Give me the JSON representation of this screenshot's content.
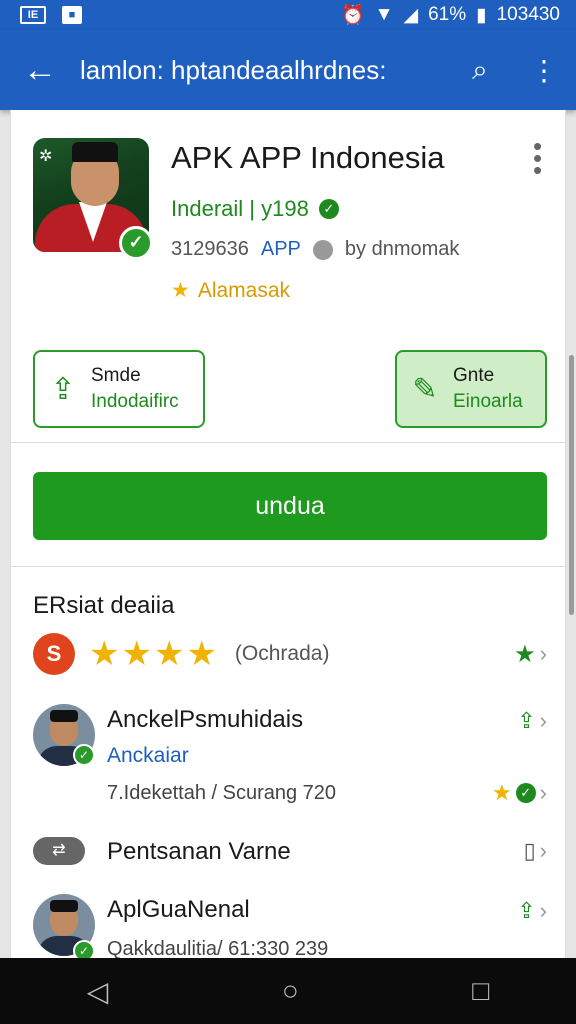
{
  "status_bar": {
    "left_icons": [
      "IE",
      "■"
    ],
    "alarm_icon": "alarm-icon",
    "signal_icon": "signal-icon",
    "battery": "61%",
    "time": "103430"
  },
  "app_bar": {
    "back_icon": "←",
    "title": "lamlon: hptandeaalhrdnes:",
    "search_icon": "⌕",
    "more_icon": "⋮"
  },
  "app": {
    "title": "APK APP Indonesia",
    "developer": "Inderail | y198",
    "downloads": "3129636",
    "type_tag": "APP",
    "by": "by dnmomak",
    "award": "Alamasak",
    "overflow_icon": "⋮"
  },
  "actions": {
    "share_l1": "Smde",
    "share_l2": "Indodaifirc",
    "edit_l1": "Gnte",
    "edit_l2": "Einoarla"
  },
  "install_label": "undua",
  "section": {
    "title": "ERsiat deaiia",
    "rating_badge": "S",
    "stars": "★★★★",
    "rating_count": "(Ochrada)"
  },
  "rows": [
    {
      "name": "AnckelPsmuhidais",
      "sub": "Anckaiar",
      "note": "7.Idekettah / Scurang 720"
    },
    {
      "pill": "⇄",
      "name": "Pentsanan Varne"
    },
    {
      "name": "AplGuaNenal",
      "note": "Qakkdaulitia/ 61:330 239"
    }
  ],
  "nav": {
    "back": "◁",
    "home": "○",
    "recents": "□"
  },
  "colors": {
    "primary": "#1f5fc0",
    "accent_green": "#1e9a1e",
    "star": "#f0b400",
    "red": "#e0441c"
  }
}
